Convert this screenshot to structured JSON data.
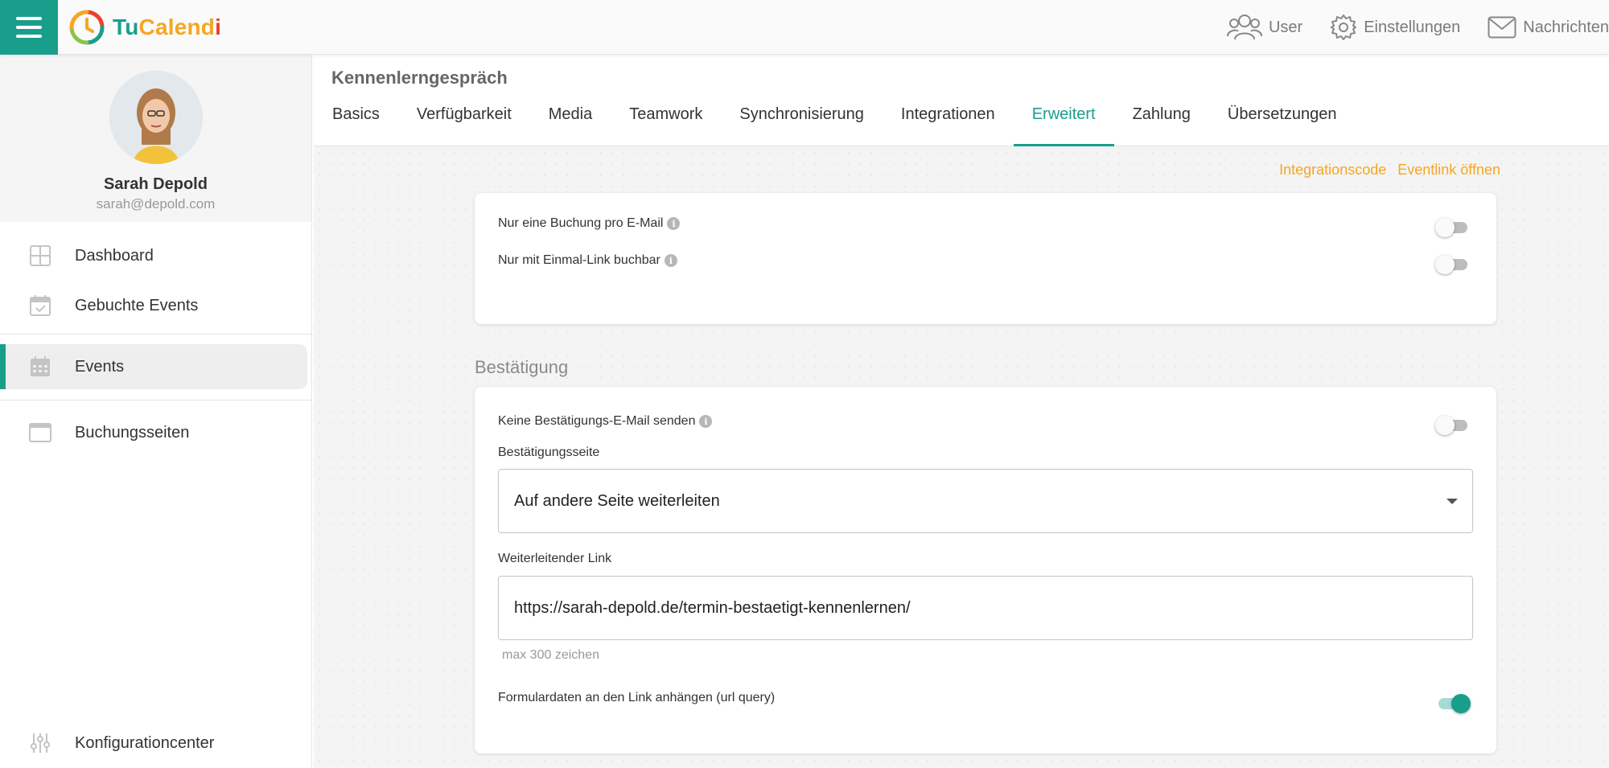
{
  "app": {
    "logo_parts": {
      "tu": "Tu",
      "cal": "Calend",
      "i": "i"
    },
    "accent_color": "#1a9e8c",
    "link_color": "#f5a623"
  },
  "topnav": {
    "user": {
      "label": "User",
      "icon": "users-icon"
    },
    "settings": {
      "label": "Einstellungen",
      "icon": "gear-icon"
    },
    "messages": {
      "label": "Nachrichten",
      "icon": "envelope-icon"
    }
  },
  "profile": {
    "name": "Sarah Depold",
    "email": "sarah@depold.com"
  },
  "sidebar": {
    "items": [
      {
        "label": "Dashboard",
        "icon": "dashboard-grid-icon"
      },
      {
        "label": "Gebuchte Events",
        "icon": "calendar-check-icon"
      },
      {
        "label": "Events",
        "icon": "calendar-icon",
        "active": true
      },
      {
        "label": "Buchungsseiten",
        "icon": "window-icon"
      },
      {
        "label": "Konfigurationcenter",
        "icon": "sliders-icon"
      }
    ]
  },
  "header": {
    "title": "Kennenlerngespräch",
    "tabs": [
      {
        "label": "Basics"
      },
      {
        "label": "Verfügbarkeit"
      },
      {
        "label": "Media"
      },
      {
        "label": "Teamwork"
      },
      {
        "label": "Synchronisierung"
      },
      {
        "label": "Integrationen"
      },
      {
        "label": "Erweitert",
        "active": true
      },
      {
        "label": "Zahlung"
      },
      {
        "label": "Übersetzungen"
      }
    ]
  },
  "content": {
    "links": {
      "integration_code": "Integrationscode",
      "open_event_link": "Eventlink öffnen"
    },
    "card1": {
      "one_booking_per_email": {
        "label": "Nur eine Buchung pro E-Mail",
        "enabled": false
      },
      "only_single_use_link": {
        "label": "Nur mit Einmal-Link buchbar",
        "enabled": false
      }
    },
    "confirmation": {
      "section_title": "Bestätigung",
      "no_confirmation_email": {
        "label": "Keine Bestätigungs-E-Mail senden",
        "enabled": false
      },
      "confirmation_page": {
        "label": "Bestätigungsseite",
        "value": "Auf andere Seite weiterleiten"
      },
      "redirect_link": {
        "label": "Weiterleitender Link",
        "value": "https://sarah-depold.de/termin-bestaetigt-kennenlernen/",
        "hint": "max 300 zeichen"
      },
      "append_form_data": {
        "label": "Formulardaten an den Link anhängen (url query)",
        "enabled": true
      }
    }
  }
}
